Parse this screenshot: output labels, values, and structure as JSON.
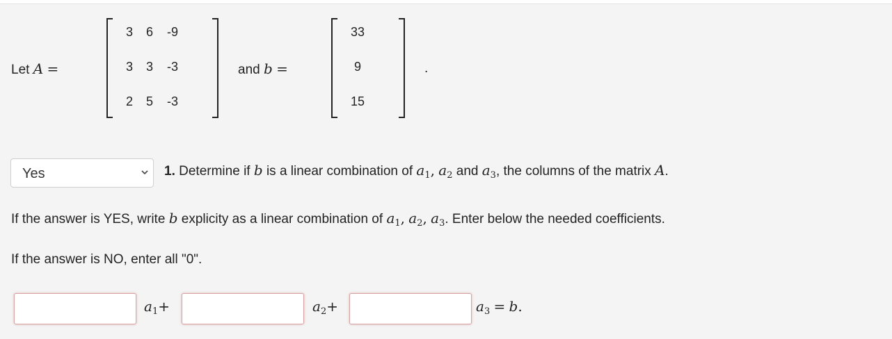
{
  "intro": {
    "let_text": "Let",
    "A_symbol": "A",
    "equals": "=",
    "and_text": "and",
    "b_symbol": "b",
    "period": "."
  },
  "matrix_A": [
    [
      "3",
      "6",
      "-9"
    ],
    [
      "3",
      "3",
      "-3"
    ],
    [
      "2",
      "5",
      "-3"
    ]
  ],
  "vector_b": [
    "33",
    "9",
    "15"
  ],
  "select": {
    "value": "Yes",
    "options": [
      "Yes"
    ]
  },
  "question": {
    "number": "1.",
    "text_1": "Determine if",
    "b": "b",
    "text_2": "is a linear combination of",
    "a": "a",
    "sub1": "1",
    "comma1": ",",
    "sub2": "2",
    "and_text": "and",
    "sub3": "3",
    "text_3": ", the columns of the matrix",
    "A": "A",
    "end": "."
  },
  "instructions": {
    "yes_1": "If the answer is YES, write",
    "yes_b": "b",
    "yes_2": "explicity as a linear combination of",
    "yes_3": ". Enter below the needed coefficients.",
    "no_text": "If the answer is NO, enter all \"0\"."
  },
  "equation": {
    "a": "a",
    "sub1": "1",
    "sub2": "2",
    "sub3": "3",
    "plus": "+",
    "equals": "=",
    "b": "b",
    "period": ".",
    "comma": ","
  },
  "inputs": [
    {
      "value": "",
      "placeholder": ""
    },
    {
      "value": "",
      "placeholder": ""
    },
    {
      "value": "",
      "placeholder": ""
    }
  ],
  "colors": {
    "panel_bg": "#f4f4f4",
    "input_border": "#d9a3a3",
    "text": "#222222"
  },
  "icons": {
    "dropdown": "chevron-down-icon"
  }
}
